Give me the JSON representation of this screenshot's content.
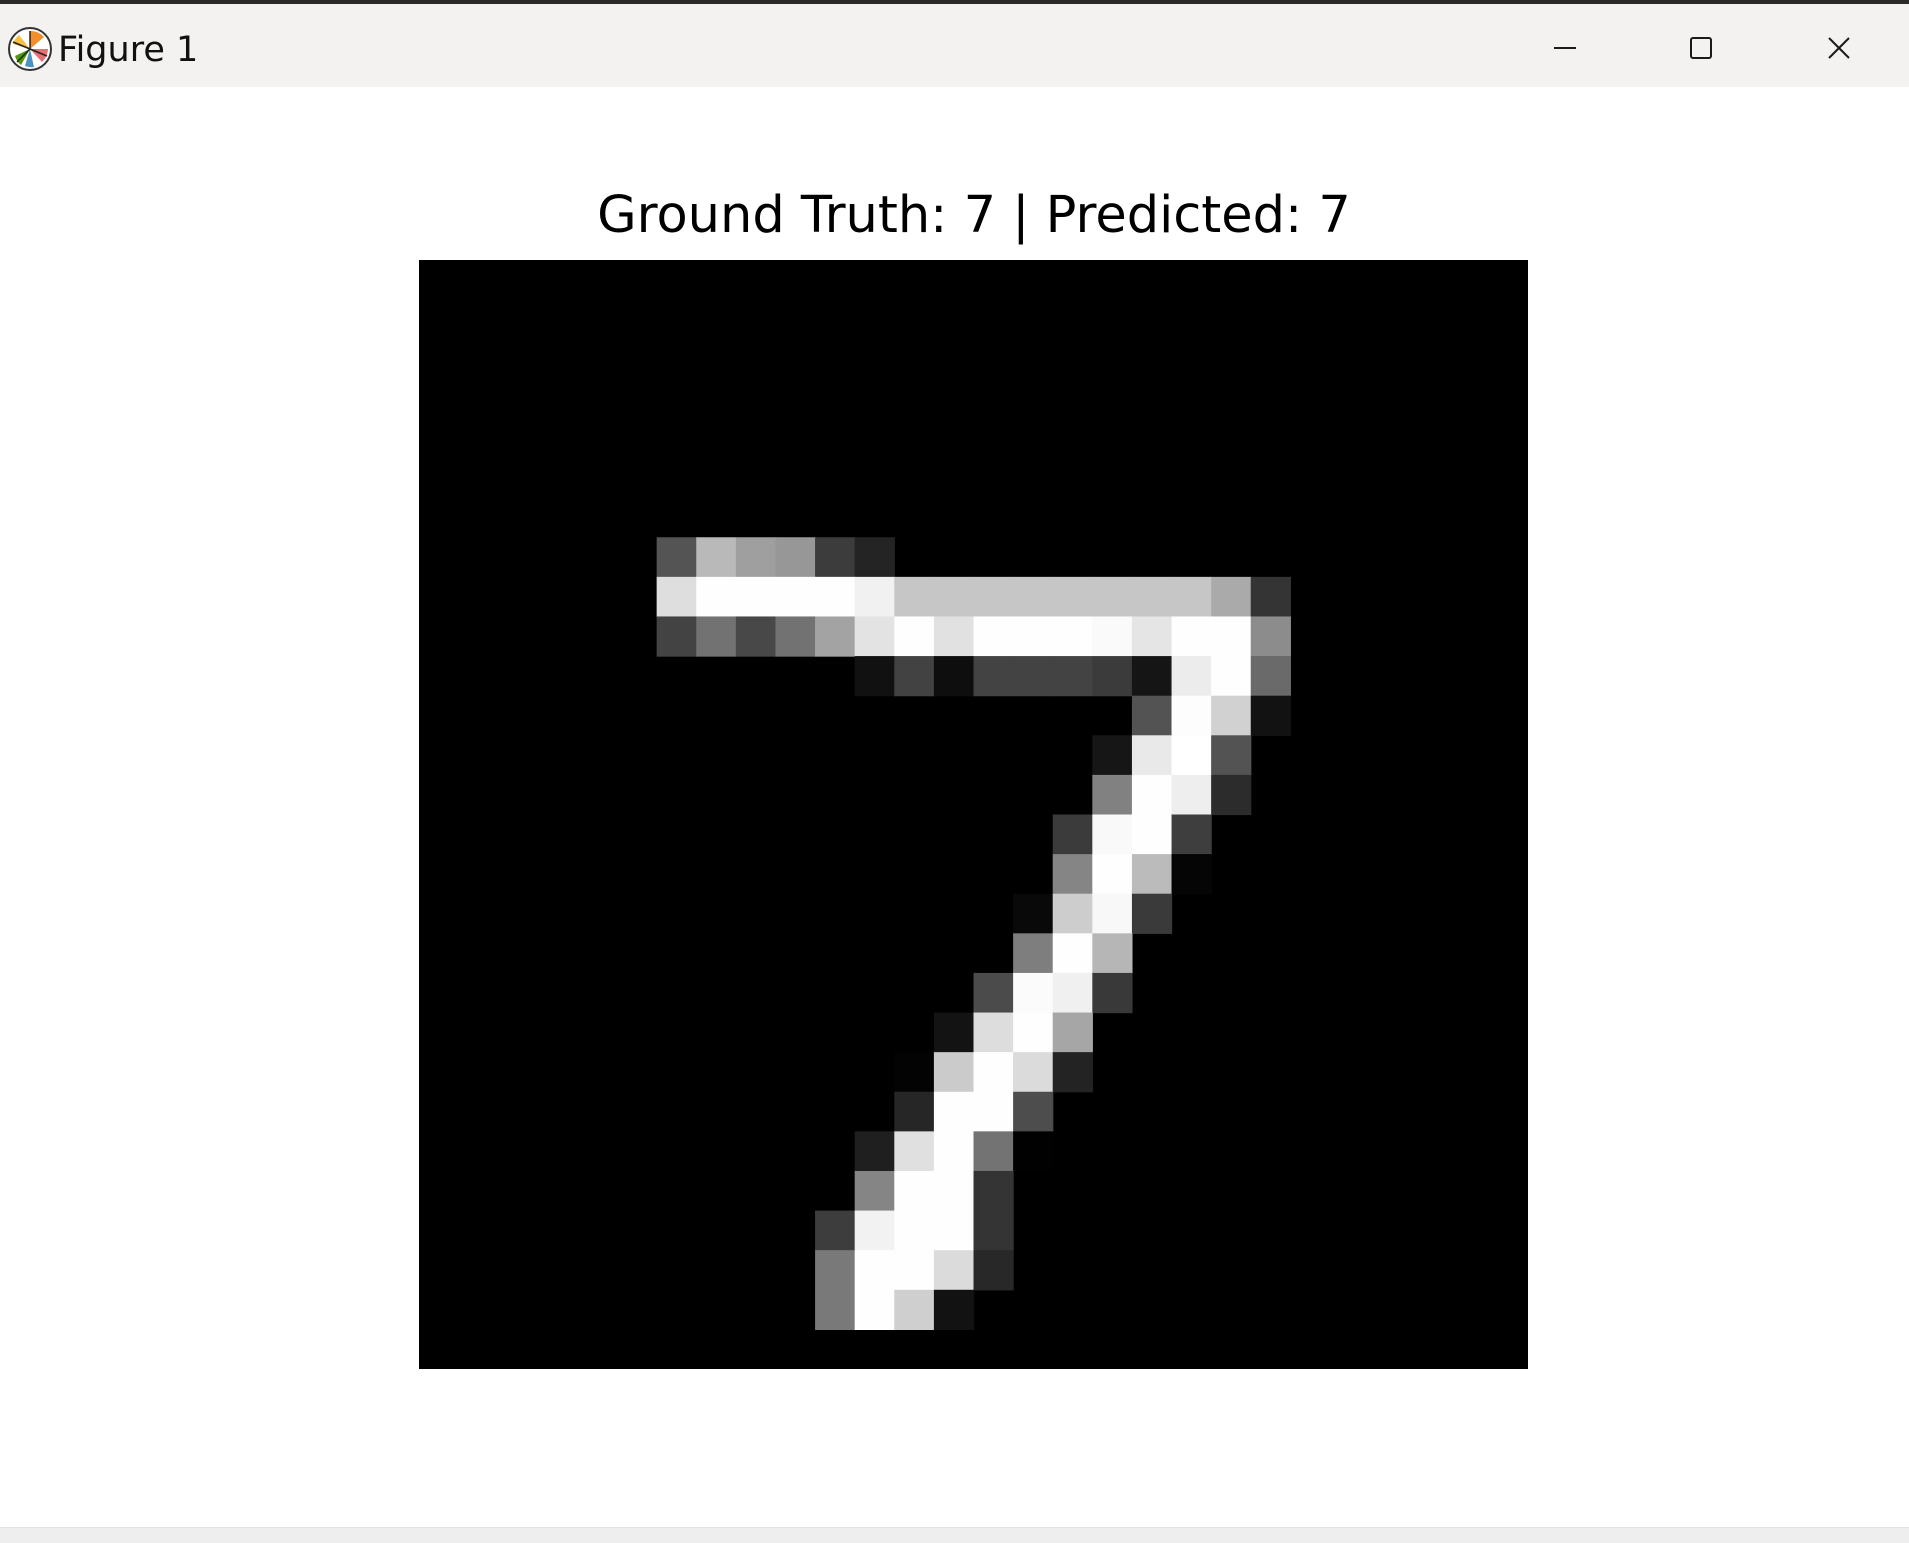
{
  "window": {
    "title": "Figure 1",
    "app_icon": "matplotlib-logo-icon",
    "controls": [
      "minimize-icon",
      "maximize-icon",
      "close-icon"
    ]
  },
  "figure": {
    "title": "Ground Truth: 7 | Predicted: 7",
    "background": "#ffffff",
    "axes_visible": false,
    "colormap": "gray"
  },
  "chart_data": {
    "type": "heatmap",
    "title": "Ground Truth: 7 | Predicted: 7",
    "colormap": "gray",
    "shape": [
      28,
      28
    ],
    "cells": [
      [
        7,
        6,
        84
      ],
      [
        7,
        7,
        185
      ],
      [
        7,
        8,
        159
      ],
      [
        7,
        9,
        151
      ],
      [
        7,
        10,
        60
      ],
      [
        7,
        11,
        36
      ],
      [
        8,
        6,
        222
      ],
      [
        8,
        7,
        254
      ],
      [
        8,
        8,
        254
      ],
      [
        8,
        9,
        254
      ],
      [
        8,
        10,
        254
      ],
      [
        8,
        11,
        241
      ],
      [
        8,
        12,
        198
      ],
      [
        8,
        13,
        198
      ],
      [
        8,
        14,
        198
      ],
      [
        8,
        15,
        198
      ],
      [
        8,
        16,
        198
      ],
      [
        8,
        17,
        198
      ],
      [
        8,
        18,
        198
      ],
      [
        8,
        19,
        198
      ],
      [
        8,
        20,
        170
      ],
      [
        8,
        21,
        52
      ],
      [
        9,
        6,
        67
      ],
      [
        9,
        7,
        114
      ],
      [
        9,
        8,
        72
      ],
      [
        9,
        9,
        114
      ],
      [
        9,
        10,
        163
      ],
      [
        9,
        11,
        227
      ],
      [
        9,
        12,
        254
      ],
      [
        9,
        13,
        225
      ],
      [
        9,
        14,
        254
      ],
      [
        9,
        15,
        254
      ],
      [
        9,
        16,
        254
      ],
      [
        9,
        17,
        250
      ],
      [
        9,
        18,
        229
      ],
      [
        9,
        19,
        254
      ],
      [
        9,
        20,
        254
      ],
      [
        9,
        21,
        140
      ],
      [
        10,
        11,
        17
      ],
      [
        10,
        12,
        66
      ],
      [
        10,
        13,
        14
      ],
      [
        10,
        14,
        67
      ],
      [
        10,
        15,
        67
      ],
      [
        10,
        16,
        67
      ],
      [
        10,
        17,
        59
      ],
      [
        10,
        18,
        21
      ],
      [
        10,
        19,
        236
      ],
      [
        10,
        20,
        254
      ],
      [
        10,
        21,
        106
      ],
      [
        11,
        18,
        83
      ],
      [
        11,
        19,
        253
      ],
      [
        11,
        20,
        209
      ],
      [
        11,
        21,
        18
      ],
      [
        12,
        17,
        22
      ],
      [
        12,
        18,
        233
      ],
      [
        12,
        19,
        255
      ],
      [
        12,
        20,
        83
      ],
      [
        13,
        17,
        129
      ],
      [
        13,
        18,
        254
      ],
      [
        13,
        19,
        238
      ],
      [
        13,
        20,
        44
      ],
      [
        14,
        16,
        59
      ],
      [
        14,
        17,
        249
      ],
      [
        14,
        18,
        254
      ],
      [
        14,
        19,
        62
      ],
      [
        15,
        16,
        133
      ],
      [
        15,
        17,
        254
      ],
      [
        15,
        18,
        187
      ],
      [
        15,
        19,
        5
      ],
      [
        16,
        15,
        9
      ],
      [
        16,
        16,
        205
      ],
      [
        16,
        17,
        248
      ],
      [
        16,
        18,
        58
      ],
      [
        17,
        15,
        126
      ],
      [
        17,
        16,
        254
      ],
      [
        17,
        17,
        182
      ],
      [
        18,
        14,
        75
      ],
      [
        18,
        15,
        251
      ],
      [
        18,
        16,
        240
      ],
      [
        18,
        17,
        57
      ],
      [
        19,
        13,
        19
      ],
      [
        19,
        14,
        221
      ],
      [
        19,
        15,
        254
      ],
      [
        19,
        16,
        166
      ],
      [
        20,
        12,
        3
      ],
      [
        20,
        13,
        203
      ],
      [
        20,
        14,
        254
      ],
      [
        20,
        15,
        219
      ],
      [
        20,
        16,
        35
      ],
      [
        21,
        12,
        38
      ],
      [
        21,
        13,
        254
      ],
      [
        21,
        14,
        254
      ],
      [
        21,
        15,
        77
      ],
      [
        22,
        11,
        31
      ],
      [
        22,
        12,
        224
      ],
      [
        22,
        13,
        254
      ],
      [
        22,
        14,
        115
      ],
      [
        22,
        15,
        1
      ],
      [
        23,
        11,
        133
      ],
      [
        23,
        12,
        254
      ],
      [
        23,
        13,
        254
      ],
      [
        23,
        14,
        52
      ],
      [
        24,
        10,
        61
      ],
      [
        24,
        11,
        242
      ],
      [
        24,
        12,
        254
      ],
      [
        24,
        13,
        254
      ],
      [
        24,
        14,
        52
      ],
      [
        25,
        10,
        121
      ],
      [
        25,
        11,
        254
      ],
      [
        25,
        12,
        254
      ],
      [
        25,
        13,
        219
      ],
      [
        25,
        14,
        40
      ],
      [
        26,
        10,
        121
      ],
      [
        26,
        11,
        254
      ],
      [
        26,
        12,
        207
      ],
      [
        26,
        13,
        18
      ]
    ]
  }
}
